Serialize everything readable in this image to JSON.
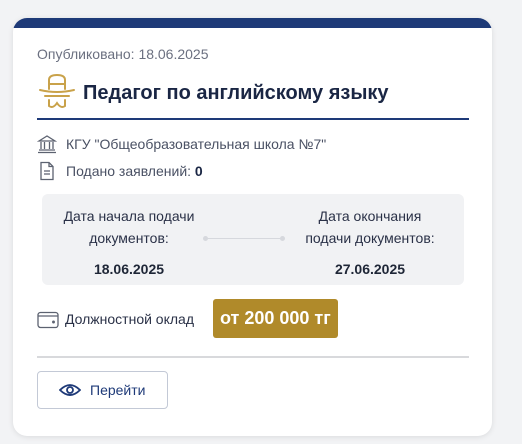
{
  "card": {
    "published_label": "Опубликовано: 18.06.2025",
    "title": "Педагог по английскому языку",
    "organization": "КГУ \"Общеобразовательная школа №7\"",
    "applications_label": "Подано заявлений:",
    "applications_count": "0",
    "start_label": "Дата начала подачи документов:",
    "start_date": "18.06.2025",
    "end_label": "Дата окончания подачи документов:",
    "end_date": "27.06.2025",
    "salary_label": "Должностной оклад",
    "salary_value": "от 200 000 тг",
    "go_button_label": "Перейти"
  },
  "icons": {
    "title": "teacher-hat-icon",
    "organization": "building-icon",
    "applications": "document-icon",
    "salary": "wallet-icon",
    "button": "eye-icon"
  },
  "colors": {
    "accent": "#1e3a78",
    "salary_badge": "#b08a2a",
    "hat_icon": "#c9a24a"
  }
}
